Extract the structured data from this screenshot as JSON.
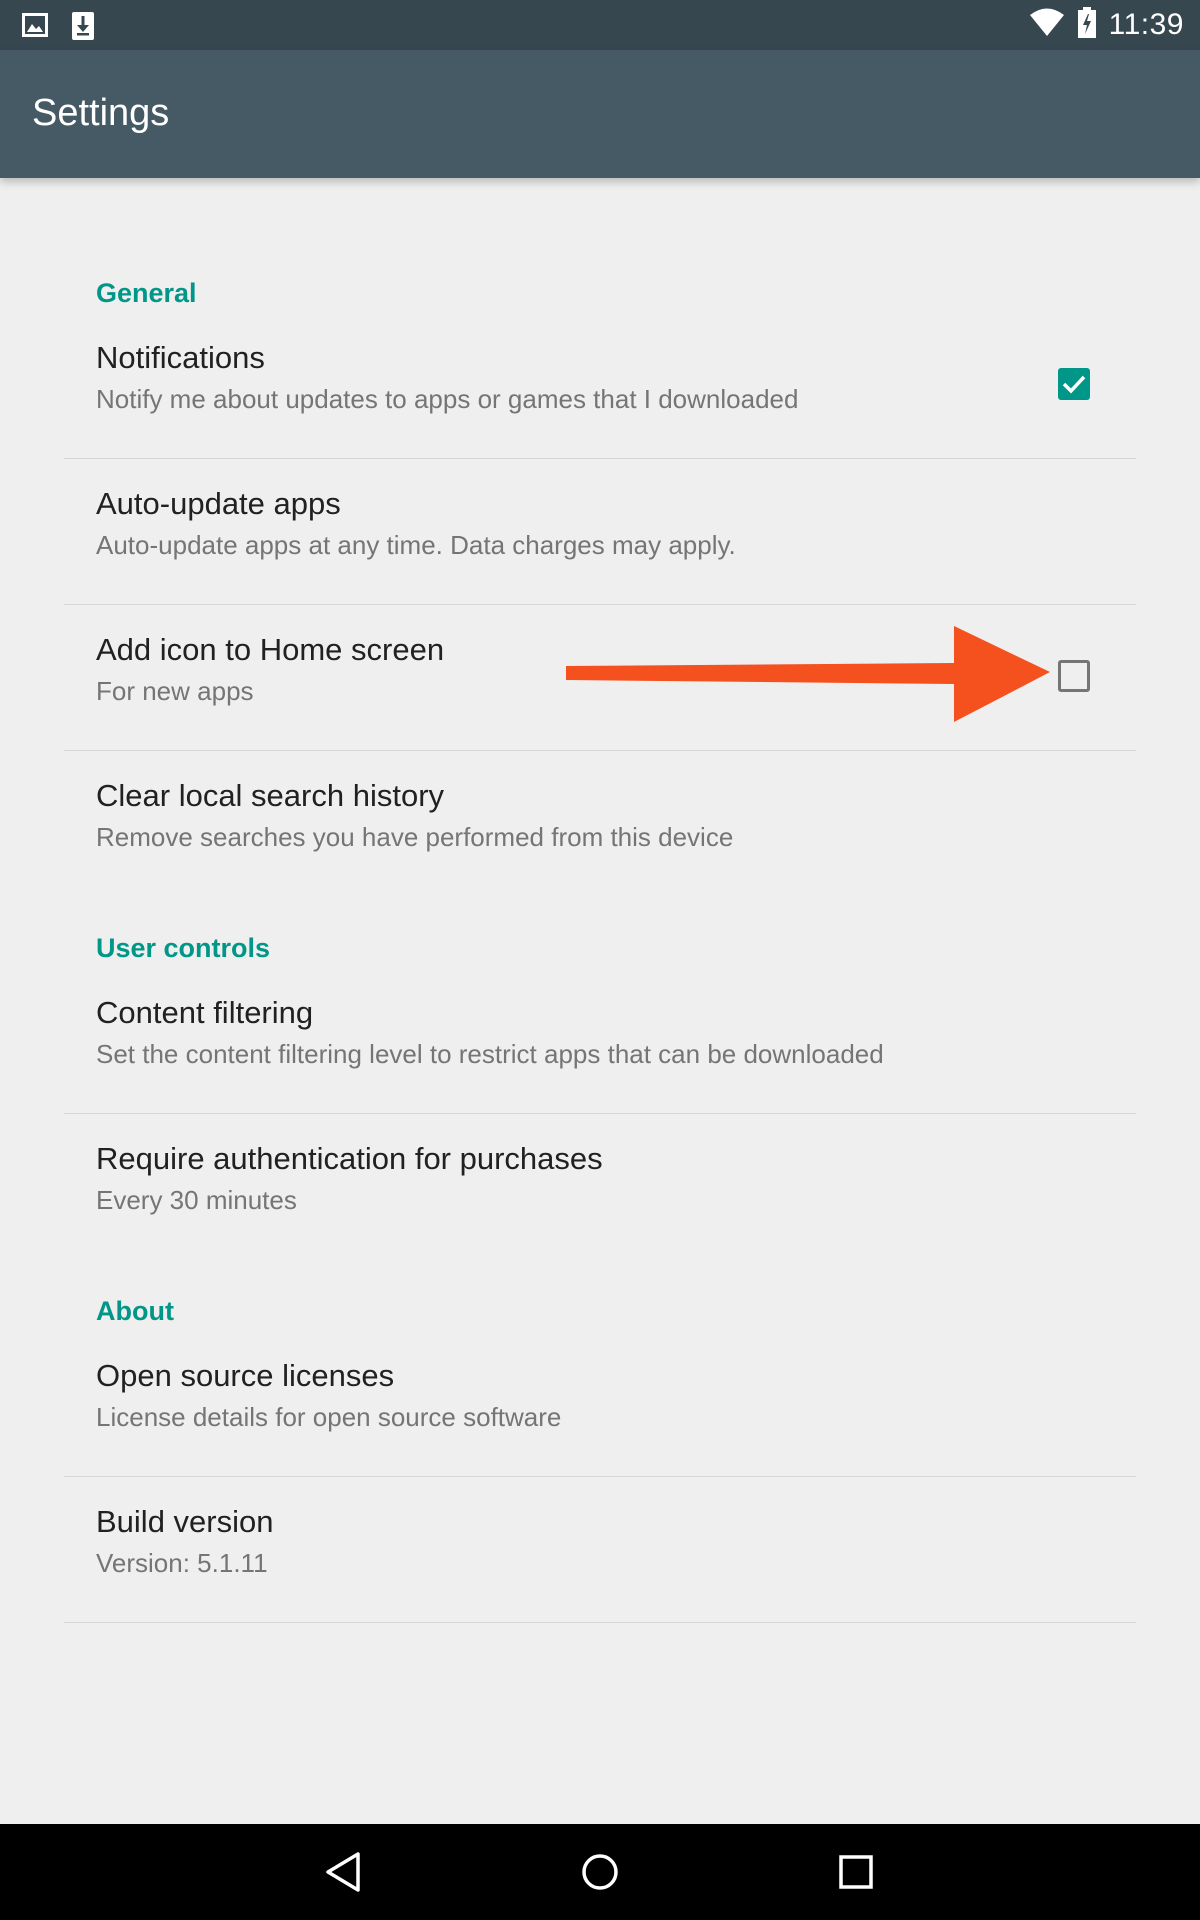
{
  "status_bar": {
    "time": "11:39",
    "icons": [
      "image-notification-icon",
      "download-notification-icon",
      "wifi-icon",
      "battery-icon"
    ]
  },
  "app_bar": {
    "title": "Settings"
  },
  "sections": {
    "general": {
      "header": "General",
      "items": [
        {
          "title": "Notifications",
          "summary": "Notify me about updates to apps or games that I downloaded",
          "checkbox": "checked"
        },
        {
          "title": "Auto-update apps",
          "summary": "Auto-update apps at any time. Data charges may apply."
        },
        {
          "title": "Add icon to Home screen",
          "summary": "For new apps",
          "checkbox": "unchecked"
        },
        {
          "title": "Clear local search history",
          "summary": "Remove searches you have performed from this device"
        }
      ]
    },
    "user_controls": {
      "header": "User controls",
      "items": [
        {
          "title": "Content filtering",
          "summary": "Set the content filtering level to restrict apps that can be downloaded"
        },
        {
          "title": "Require authentication for purchases",
          "summary": "Every 30 minutes"
        }
      ]
    },
    "about": {
      "header": "About",
      "items": [
        {
          "title": "Open source licenses",
          "summary": "License details for open source software"
        },
        {
          "title": "Build version",
          "summary": "Version: 5.1.11"
        }
      ]
    }
  },
  "colors": {
    "accent": "#009688",
    "app_bar": "#455a64",
    "status_bar": "#37474f",
    "annotation_arrow": "#f4511e"
  },
  "navigation_bar": {
    "icons": [
      "back-icon",
      "home-icon",
      "recents-icon"
    ]
  }
}
